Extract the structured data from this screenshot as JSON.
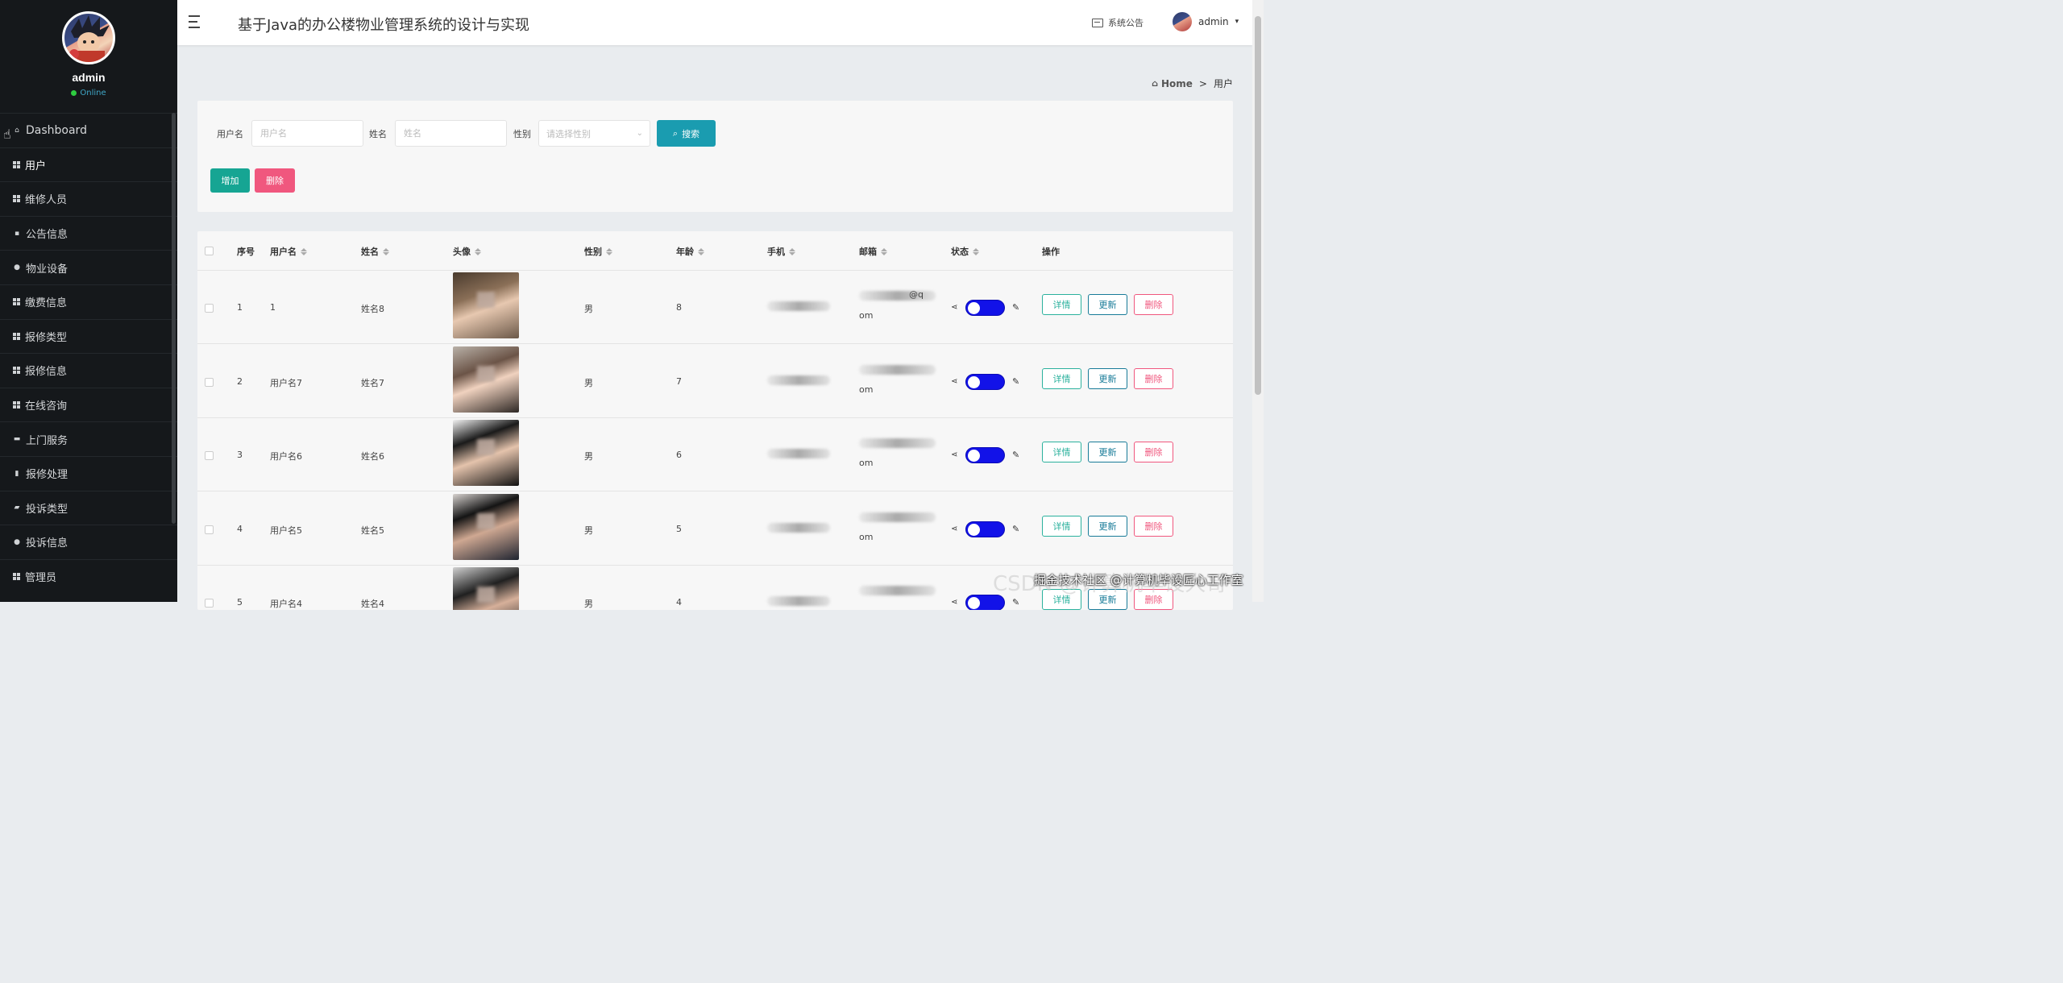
{
  "app": {
    "title": "基于Java的办公楼物业管理系统的设计与实现"
  },
  "profile": {
    "name": "admin",
    "status": "Online"
  },
  "sidebar": {
    "items": [
      {
        "label": "Dashboard",
        "icon": "home-icon"
      },
      {
        "label": "用户",
        "icon": "grid-icon",
        "active": true
      },
      {
        "label": "维修人员",
        "icon": "grid-icon"
      },
      {
        "label": "公告信息",
        "icon": "comment-icon"
      },
      {
        "label": "物业设备",
        "icon": "user-icon"
      },
      {
        "label": "缴费信息",
        "icon": "grid-icon"
      },
      {
        "label": "报修类型",
        "icon": "grid-icon"
      },
      {
        "label": "报修信息",
        "icon": "grid-icon"
      },
      {
        "label": "在线咨询",
        "icon": "grid-icon"
      },
      {
        "label": "上门服务",
        "icon": "briefcase-icon"
      },
      {
        "label": "报修处理",
        "icon": "bar-chart-icon"
      },
      {
        "label": "投诉类型",
        "icon": "folder-icon"
      },
      {
        "label": "投诉信息",
        "icon": "user-icon"
      },
      {
        "label": "管理员",
        "icon": "grid-icon"
      }
    ]
  },
  "header": {
    "notice_label": "系统公告",
    "user_label": "admin"
  },
  "breadcrumb": {
    "home": "Home",
    "separator": ">",
    "current": "用户"
  },
  "search": {
    "username_label": "用户名",
    "username_placeholder": "用户名",
    "name_label": "姓名",
    "name_placeholder": "姓名",
    "gender_label": "性别",
    "gender_placeholder": "请选择性别",
    "search_button": "搜索",
    "add_button": "增加",
    "delete_button": "删除"
  },
  "table": {
    "headers": {
      "index": "序号",
      "username": "用户名",
      "name": "姓名",
      "avatar": "头像",
      "gender": "性别",
      "age": "年龄",
      "phone": "手机",
      "email": "邮箱",
      "status": "状态",
      "actions": "操作"
    },
    "action_labels": {
      "detail": "详情",
      "update": "更新",
      "delete": "删除"
    },
    "rows": [
      {
        "index": "1",
        "username": "1",
        "name": "姓名8",
        "gender": "男",
        "age": "8",
        "email_tail": "om",
        "email_visible": "@q",
        "status_on": true
      },
      {
        "index": "2",
        "username": "用户名7",
        "name": "姓名7",
        "gender": "男",
        "age": "7",
        "email_tail": "om",
        "status_on": true
      },
      {
        "index": "3",
        "username": "用户名6",
        "name": "姓名6",
        "gender": "男",
        "age": "6",
        "email_tail": "om",
        "status_on": true
      },
      {
        "index": "4",
        "username": "用户名5",
        "name": "姓名5",
        "gender": "男",
        "age": "5",
        "email_tail": "om",
        "status_on": true
      },
      {
        "index": "5",
        "username": "用户名4",
        "name": "姓名4",
        "gender": "男",
        "age": "4",
        "email_tail": "",
        "status_on": true
      }
    ]
  },
  "watermark": {
    "back": "CSDN @计算机毕设大哥",
    "front": "掘金技术社区 @计算机毕设匠心工作室"
  },
  "colors": {
    "sidebar_bg": "#15181b",
    "search_button": "#1a9cb0",
    "add_button": "#16a593",
    "delete_button": "#f0577e",
    "toggle_on": "#1212e8"
  }
}
